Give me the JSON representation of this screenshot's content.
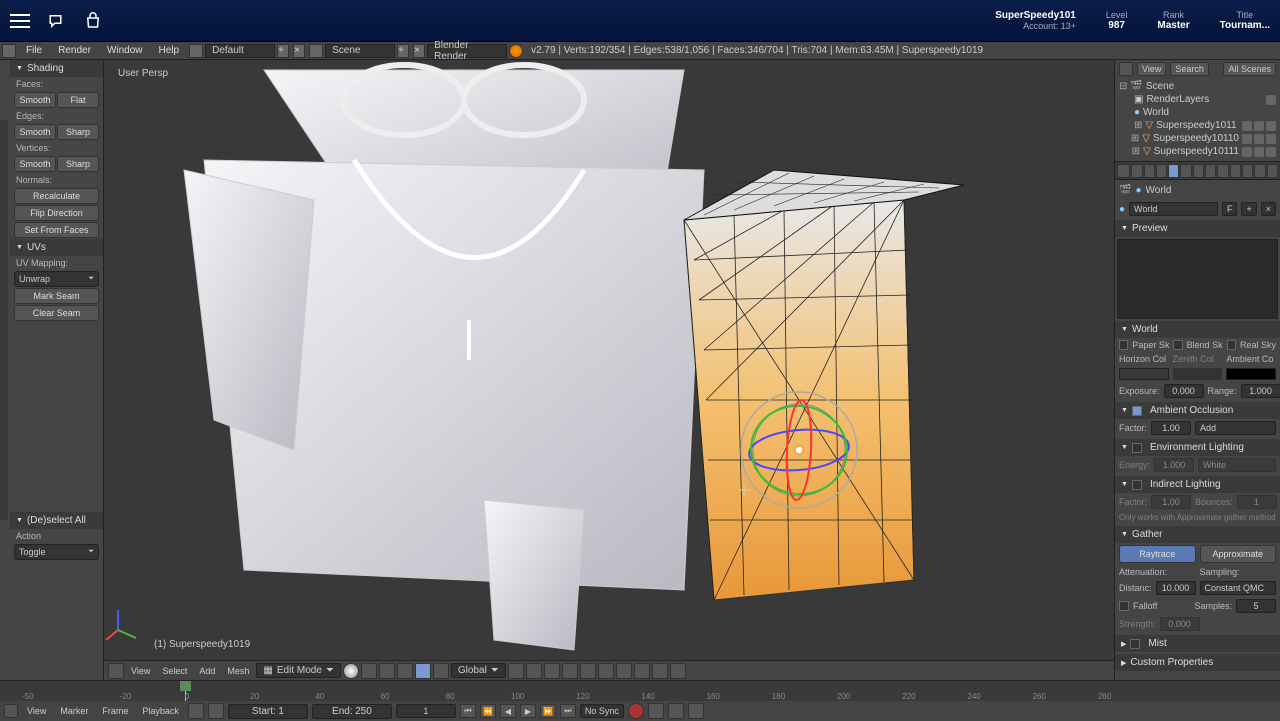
{
  "site_header": {
    "user_name": "SuperSpeedy101",
    "account": "Account: 13+",
    "stats": [
      {
        "label": "Level",
        "value": "987"
      },
      {
        "label": "Rank",
        "value": "Master"
      },
      {
        "label": "Title",
        "value": "Tournam..."
      }
    ]
  },
  "top_menu": {
    "items": [
      "File",
      "Render",
      "Window",
      "Help"
    ],
    "layout": "Default",
    "scene": "Scene",
    "engine": "Blender Render",
    "stats": "v2.79 | Verts:192/354 | Edges:538/1,056 | Faces:346/704 | Tris:704 | Mem:63.45M | Superspeedy1019"
  },
  "left_shelf": {
    "shading": {
      "title": "Shading",
      "faces": {
        "label": "Faces:",
        "buttons": [
          "Smooth",
          "Flat"
        ]
      },
      "edges": {
        "label": "Edges:",
        "buttons": [
          "Smooth",
          "Sharp"
        ]
      },
      "vertices": {
        "label": "Vertices:",
        "buttons": [
          "Smooth",
          "Sharp"
        ]
      },
      "normals": {
        "label": "Normals:",
        "buttons": [
          "Recalculate",
          "Flip Direction",
          "Set From Faces"
        ]
      }
    },
    "uvs": {
      "title": "UVs",
      "mapping_label": "UV Mapping:",
      "unwrap": "Unwrap",
      "buttons": [
        "Mark Seam",
        "Clear Seam"
      ]
    }
  },
  "operator": {
    "title": "(De)select All",
    "action_label": "Action",
    "action_value": "Toggle"
  },
  "viewport": {
    "persp_label": "User Persp",
    "object_label": "(1) Superspeedy1019"
  },
  "viewport_header": {
    "menus": [
      "View",
      "Select",
      "Add",
      "Mesh"
    ],
    "mode": "Edit Mode",
    "orientation": "Global"
  },
  "outliner": {
    "header_buttons": [
      "View",
      "Search"
    ],
    "filter": "All Scenes",
    "items": [
      {
        "name": "Scene",
        "indent": 0,
        "icon": "scene"
      },
      {
        "name": "RenderLayers",
        "indent": 1,
        "icon": "layers",
        "extra": true
      },
      {
        "name": "World",
        "indent": 1,
        "icon": "world"
      },
      {
        "name": "Superspeedy1011",
        "indent": 1,
        "icon": "mesh",
        "vis": true
      },
      {
        "name": "Superspeedy10110",
        "indent": 1,
        "icon": "mesh",
        "vis": true
      },
      {
        "name": "Superspeedy10111",
        "indent": 1,
        "icon": "mesh",
        "vis": true
      }
    ]
  },
  "properties": {
    "context": "World",
    "world_name": "World",
    "preview": "Preview",
    "world_panel": "World",
    "checks": [
      "Paper Sk",
      "Blend Sk",
      "Real Sky"
    ],
    "horizon": "Horizon Col",
    "zenith": "Zenith Col",
    "ambient": "Ambient Co",
    "exposure": {
      "label": "Exposure:",
      "value": "0.000"
    },
    "range": {
      "label": "Range:",
      "value": "1.000"
    },
    "ao": {
      "title": "Ambient Occlusion",
      "factor_label": "Factor:",
      "factor": "1.00",
      "blend": "Add"
    },
    "env": {
      "title": "Environment Lighting",
      "energy_label": "Energy:",
      "energy": "1.000",
      "color": "White"
    },
    "indirect": {
      "title": "Indirect Lighting",
      "factor_label": "Factor:",
      "factor": "1.00",
      "bounces_label": "Bounces:",
      "bounces": "1",
      "note": "Only works with Approximate gather method"
    },
    "gather": {
      "title": "Gather",
      "raytrace": "Raytrace",
      "approximate": "Approximate",
      "attenuation": "Attenuation:",
      "sampling": "Sampling:",
      "distance_label": "Distanc:",
      "distance": "10.000",
      "method": "Constant QMC",
      "falloff": "Falloff",
      "samples_label": "Samples:",
      "samples": "5",
      "strength_label": "Strength:",
      "strength": "0.000"
    },
    "mist": "Mist",
    "custom": "Custom Properties"
  },
  "timeline": {
    "menus": [
      "View",
      "Marker",
      "Frame",
      "Playback"
    ],
    "start_label": "Start:",
    "start": "1",
    "end_label": "End:",
    "end": "250",
    "current": "1",
    "sync": "No Sync",
    "ticks": [
      -50,
      -20,
      0,
      20,
      40,
      60,
      80,
      100,
      120,
      140,
      160,
      180,
      200,
      220,
      240,
      260,
      280
    ]
  }
}
